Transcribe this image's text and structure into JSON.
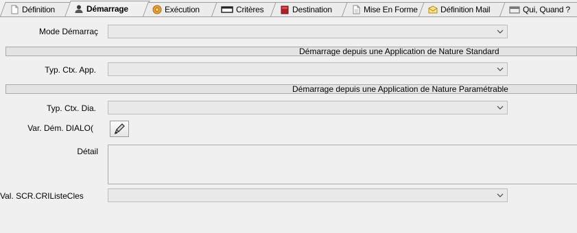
{
  "tabs": [
    {
      "label": "Définition",
      "icon": "document-icon",
      "active": false
    },
    {
      "label": "Démarrage",
      "icon": "user-icon",
      "active": true
    },
    {
      "label": "Exécution",
      "icon": "gear-icon",
      "active": false
    },
    {
      "label": "Critères",
      "icon": "rectangle-icon",
      "active": false
    },
    {
      "label": "Destination",
      "icon": "book-icon",
      "active": false
    },
    {
      "label": "Mise En Forme",
      "icon": "document-icon",
      "active": false
    },
    {
      "label": "Définition Mail",
      "icon": "envelope-icon",
      "active": false
    },
    {
      "label": "Qui, Quand ?",
      "icon": "calendar-icon",
      "active": false
    }
  ],
  "form": {
    "mode_demarrage": {
      "label": "Mode Démarraç",
      "value": ""
    },
    "section_standard": "Démarrage depuis une Application de Nature Standard",
    "typ_ctx_app": {
      "label": "Typ. Ctx. App.",
      "value": ""
    },
    "section_parametrable": "Démarrage depuis une Application de Nature Paramétrable",
    "typ_ctx_dia": {
      "label": "Typ. Ctx. Dia.",
      "value": ""
    },
    "var_dem_dialog": {
      "label": "Var. Dém. DIALO(",
      "button_icon": "edit-pen-icon"
    },
    "detail": {
      "label": "Détail",
      "value": ""
    },
    "val_scr": {
      "label": "Val. SCR.CRIListeCles",
      "value": ""
    }
  },
  "colors": {
    "window": "#f0f0f0",
    "field": "#e9e9e9",
    "section": "#e3e3e3"
  }
}
